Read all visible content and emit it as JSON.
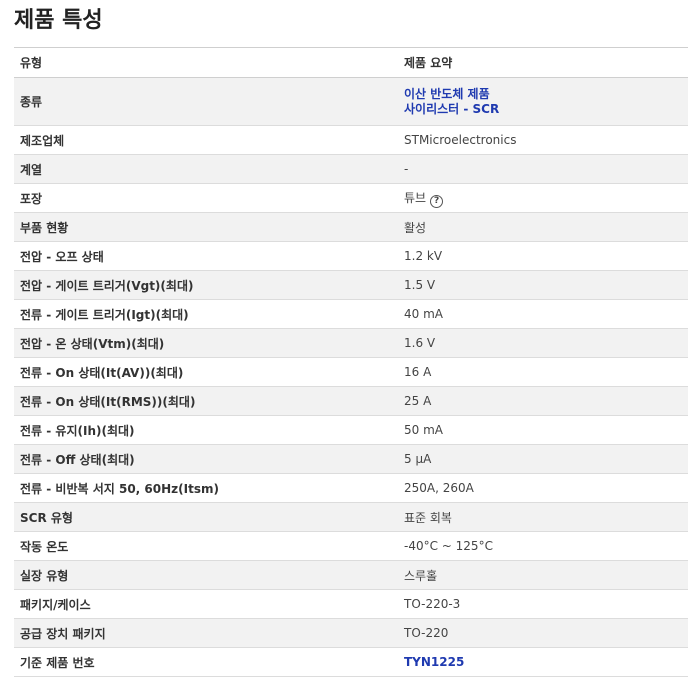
{
  "section_title": "제품 특성",
  "header": {
    "key": "유형",
    "value": "제품 요약"
  },
  "category": {
    "label": "종류",
    "links": [
      "이산 반도체 제품",
      "사이리스터 - SCR"
    ]
  },
  "rows": [
    {
      "label": "제조업체",
      "value": "STMicroelectronics"
    },
    {
      "label": "계열",
      "value": "-"
    },
    {
      "label": "포장",
      "value": "튜브"
    },
    {
      "label": "부품 현황",
      "value": "활성"
    },
    {
      "label": "전압 - 오프 상태",
      "value": "1.2 kV"
    },
    {
      "label": "전압 - 게이트 트리거(Vgt)(최대)",
      "value": "1.5 V"
    },
    {
      "label": "전류 - 게이트 트리거(Igt)(최대)",
      "value": "40 mA"
    },
    {
      "label": "전압 - 온 상태(Vtm)(최대)",
      "value": "1.6 V"
    },
    {
      "label": "전류 - On 상태(It(AV))(최대)",
      "value": "16 A"
    },
    {
      "label": "전류 - On 상태(It(RMS))(최대)",
      "value": "25 A"
    },
    {
      "label": "전류 - 유지(Ih)(최대)",
      "value": "50 mA"
    },
    {
      "label": "전류 - Off 상태(최대)",
      "value": "5 µA"
    },
    {
      "label": "전류 - 비반복 서지 50, 60Hz(Itsm)",
      "value": "250A, 260A"
    },
    {
      "label": "SCR 유형",
      "value": "표준 회복"
    },
    {
      "label": "작동 온도",
      "value": "-40°C ~ 125°C"
    },
    {
      "label": "실장 유형",
      "value": "스루홀"
    },
    {
      "label": "패키지/케이스",
      "value": "TO-220-3"
    },
    {
      "label": "공급 장치 패키지",
      "value": "TO-220"
    },
    {
      "label": "기준 제품 번호",
      "value": "TYN1225"
    }
  ],
  "help_icon": "?",
  "link_color": "#1f3ab0"
}
